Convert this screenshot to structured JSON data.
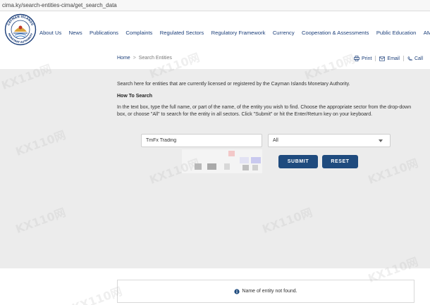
{
  "browser": {
    "url": "cima.ky/search-entities-cima/get_search_data"
  },
  "logo": {
    "ring_text_top": "CAYMAN ISLANDS",
    "ring_text_bottom": "MONETARY AUTHORITY"
  },
  "nav": {
    "items": [
      "About Us",
      "News",
      "Publications",
      "Complaints",
      "Regulated Sectors",
      "Regulatory Framework",
      "Currency",
      "Cooperation & Assessments",
      "Public Education",
      "AML/CFT"
    ]
  },
  "breadcrumb": {
    "home": "Home",
    "separator": ">",
    "current": "Search Entities"
  },
  "actions": {
    "print": "Print",
    "email": "Email",
    "call": "Call"
  },
  "content": {
    "intro": "Search here for entities that are currently licensed or registered by the Cayman Islands Monetary Authority.",
    "howto_title": "How To Search",
    "howto_text": "In the text box, type the full name, or part of the name, of the entity you wish to find. Choose the appropriate sector from the drop-down box, or choose \"All\" to search for the entity in all sectors. Click \"Submit\" or hit the Enter/Return key on your keyboard."
  },
  "search": {
    "value": "TmFx Trading",
    "sector_selected": "All"
  },
  "buttons": {
    "submit": "SUBMIT",
    "reset": "RESET"
  },
  "result": {
    "message": "Name of entity not found."
  },
  "watermark": {
    "text": "KX110网"
  },
  "colors": {
    "brand": "#1f4b7e",
    "nav": "#1c3f7a",
    "background": "#ececec"
  }
}
